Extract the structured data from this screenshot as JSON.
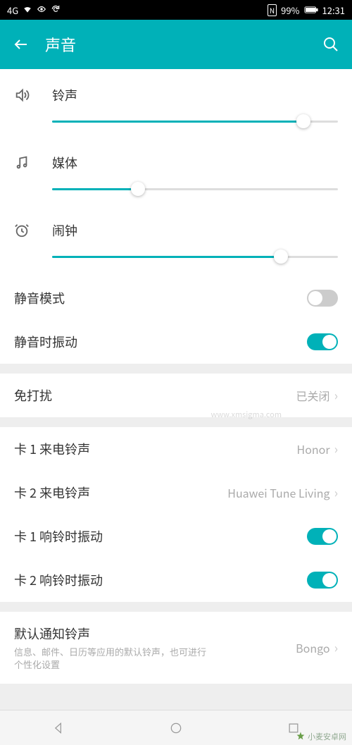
{
  "status": {
    "signal": "4G",
    "nfc": "N",
    "battery": "99%",
    "time": "12:31"
  },
  "header": {
    "title": "声音"
  },
  "volumes": {
    "ringtone": {
      "label": "铃声",
      "percent": 88
    },
    "media": {
      "label": "媒体",
      "percent": 30
    },
    "alarm": {
      "label": "闹钟",
      "percent": 80
    }
  },
  "settings": {
    "silent_mode": {
      "label": "静音模式",
      "on": false
    },
    "vibrate_silent": {
      "label": "静音时振动",
      "on": true
    },
    "dnd": {
      "label": "免打扰",
      "value": "已关闭"
    },
    "sim1_ringtone": {
      "label": "卡 1 来电铃声",
      "value": "Honor"
    },
    "sim2_ringtone": {
      "label": "卡 2 来电铃声",
      "value": "Huawei Tune Living"
    },
    "sim1_vibrate": {
      "label": "卡 1 响铃时振动",
      "on": true
    },
    "sim2_vibrate": {
      "label": "卡 2 响铃时振动",
      "on": true
    },
    "default_notif": {
      "label": "默认通知铃声",
      "sub": "信息、邮件、日历等应用的默认铃声，也可进行个性化设置",
      "value": "Bongo"
    }
  },
  "watermark": {
    "site": "小麦安卓网",
    "url": "www.xmsigma.com"
  }
}
